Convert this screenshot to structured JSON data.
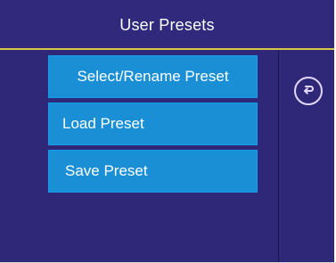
{
  "header": {
    "title": "User Presets"
  },
  "menu": {
    "items": [
      {
        "label": "Select/Rename Preset"
      },
      {
        "label": "Load Preset"
      },
      {
        "label": "Save Preset"
      }
    ]
  },
  "icons": {
    "back": "return-arrow-icon"
  },
  "colors": {
    "background": "#2e2878",
    "header_border": "#d9c54a",
    "button": "#1b8fd6",
    "button_text": "#ffffff",
    "icon_stroke": "#e2d7ff"
  }
}
